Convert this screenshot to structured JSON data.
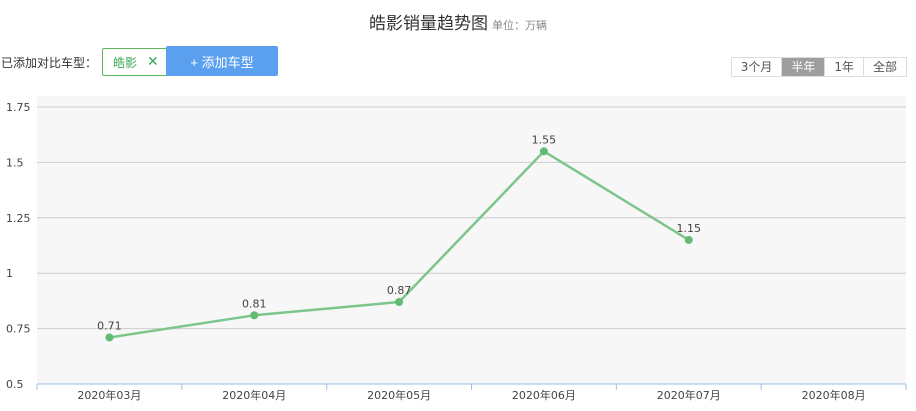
{
  "header": {
    "title": "皓影销量趋势图",
    "unit": "单位：万辆"
  },
  "compare": {
    "label": "已添加对比车型：",
    "chip_label": "皓影",
    "add_button": "+ 添加车型"
  },
  "range_tabs": [
    {
      "label": "3个月",
      "active": false
    },
    {
      "label": "半年",
      "active": true
    },
    {
      "label": "1年",
      "active": false
    },
    {
      "label": "全部",
      "active": false
    }
  ],
  "colors": {
    "line": "#7cc58b",
    "point": "#62bb74",
    "grid": "#cccccc",
    "plot_bg": "#f7f7f7",
    "axis": "#9ec3e8"
  },
  "chart_data": {
    "type": "line",
    "categories": [
      "2020年03月",
      "2020年04月",
      "2020年05月",
      "2020年06月",
      "2020年07月",
      "2020年08月"
    ],
    "series": [
      {
        "values": [
          0.71,
          0.81,
          0.87,
          1.55,
          1.15,
          null
        ]
      }
    ],
    "data_labels": [
      "0.71",
      "0.81",
      "0.87",
      "1.55",
      "1.15"
    ],
    "yticks": [
      "0.5",
      "0.75",
      "1",
      "1.25",
      "1.5",
      "1.75"
    ],
    "ylim": [
      0.5,
      1.75
    ],
    "grid": true,
    "legend": "none"
  }
}
